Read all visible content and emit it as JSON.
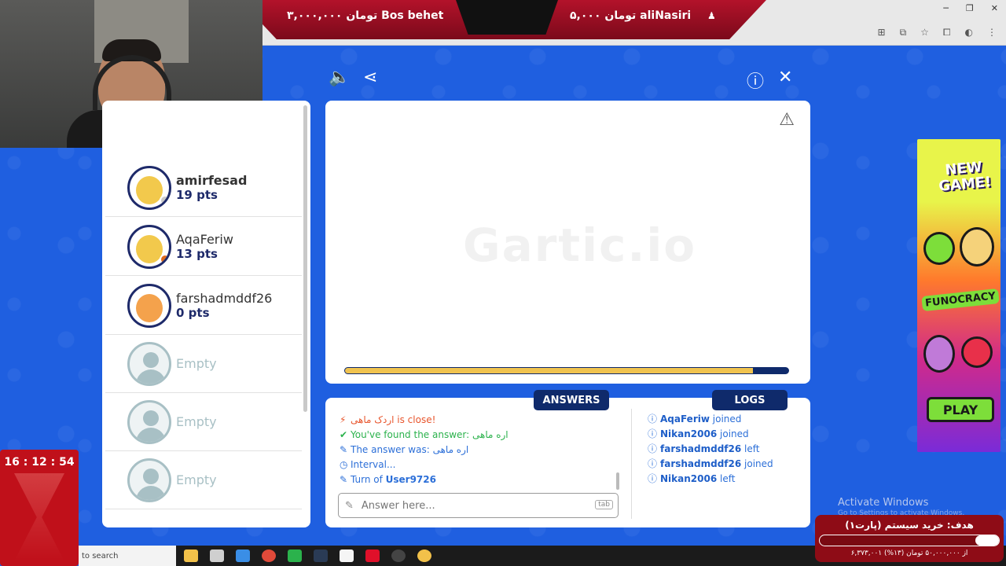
{
  "donation": {
    "left": "۳,۰۰۰,۰۰۰ تومان  Bos behet",
    "right": "۵,۰۰۰ تومان  aliNasiri"
  },
  "players": [
    {
      "name": "amirfesad",
      "pts": "19 pts",
      "status_color": "#c9c9c9",
      "face_color": "#f2c94c"
    },
    {
      "name": "AqaFeriw",
      "pts": "13 pts",
      "status_color": "#e06a1a",
      "face_color": "#f2c94c"
    },
    {
      "name": "farshadmddf26",
      "pts": "0 pts",
      "status_color": "",
      "face_color": "#f4a24c"
    }
  ],
  "empty_slots": [
    "Empty",
    "Empty",
    "Empty"
  ],
  "canvas": {
    "watermark": "Gartic.io",
    "progress_fraction": 0.92
  },
  "tabs": {
    "answers": "ANSWERS",
    "logs": "LOGS"
  },
  "chat": [
    {
      "type": "close",
      "icon": "⚡",
      "text": "اردک ماهی is close!"
    },
    {
      "type": "found",
      "icon": "✔",
      "text": "You've found the answer: اره ماهی"
    },
    {
      "type": "ans",
      "icon": "✎",
      "prefix": "The answer was: ",
      "value": "اره ماهی"
    },
    {
      "type": "ans",
      "icon": "◷",
      "prefix": "Interval...",
      "value": ""
    },
    {
      "type": "turn",
      "icon": "✎",
      "prefix": "Turn of ",
      "value": "User9726"
    }
  ],
  "answer_placeholder": "Answer here...",
  "tab_key": "tab",
  "logs": [
    {
      "user": "AqaFeriw",
      "action": "joined"
    },
    {
      "user": "Nikan2006",
      "action": "joined"
    },
    {
      "user": "farshadmddf26",
      "action": "left"
    },
    {
      "user": "farshadmddf26",
      "action": "joined"
    },
    {
      "user": "Nikan2006",
      "action": "left"
    }
  ],
  "ad": {
    "new_game": "NEW GAME!",
    "brand": "FUNOCRACY",
    "play": "PLAY"
  },
  "timer": "16 : 12 : 54",
  "taskbar": {
    "search": "to search"
  },
  "activate": {
    "title": "Activate Windows",
    "sub": "Go to Settings to activate Windows."
  },
  "goal": {
    "title": "هدف: خرید سیستم (پارت۱)",
    "sub": "۶,۳۷۳,۰۰۱ از ۵۰,۰۰۰,۰۰۰ تومان (۱۳%)",
    "fraction": 0.13
  }
}
